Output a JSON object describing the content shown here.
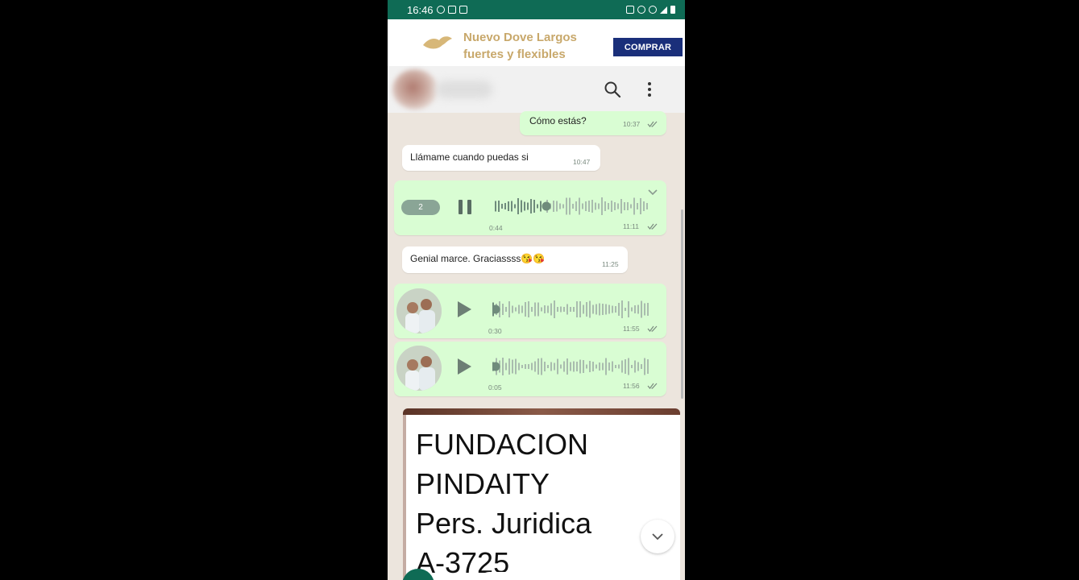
{
  "status_bar": {
    "time": "16:46"
  },
  "ad": {
    "headline": "Nuevo Dove Largos fuertes y flexibles",
    "cta_label": "COMPRAR",
    "brand_color": "#c8a86b",
    "button_color": "#1a2f7a"
  },
  "header": {
    "icons": [
      "search-icon",
      "more-vert-icon"
    ]
  },
  "messages": [
    {
      "type": "text",
      "direction": "out",
      "text": "Cómo estás?",
      "time": "10:37"
    },
    {
      "type": "text",
      "direction": "in",
      "text": "Llámame cuando puedas si",
      "time": "10:47"
    },
    {
      "type": "voice",
      "direction": "out",
      "state": "playing",
      "speed": "2",
      "duration": "0:44",
      "time": "11:11"
    },
    {
      "type": "text",
      "direction": "in",
      "text": "Genial marce. Graciassss😘😘",
      "time": "11:25"
    },
    {
      "type": "voice",
      "direction": "out",
      "state": "paused",
      "duration": "0:30",
      "time": "11:55"
    },
    {
      "type": "voice",
      "direction": "out",
      "state": "paused",
      "duration": "0:05",
      "time": "11:56"
    }
  ],
  "document_preview": {
    "lines": [
      "FUNDACION",
      "PINDAITY",
      "Pers. Juridica",
      "A-3725"
    ]
  },
  "colors": {
    "header_green": "#0f6b55",
    "outgoing_bubble": "#d9fdd3",
    "incoming_bubble": "#ffffff",
    "chat_background": "#ece5dd"
  }
}
